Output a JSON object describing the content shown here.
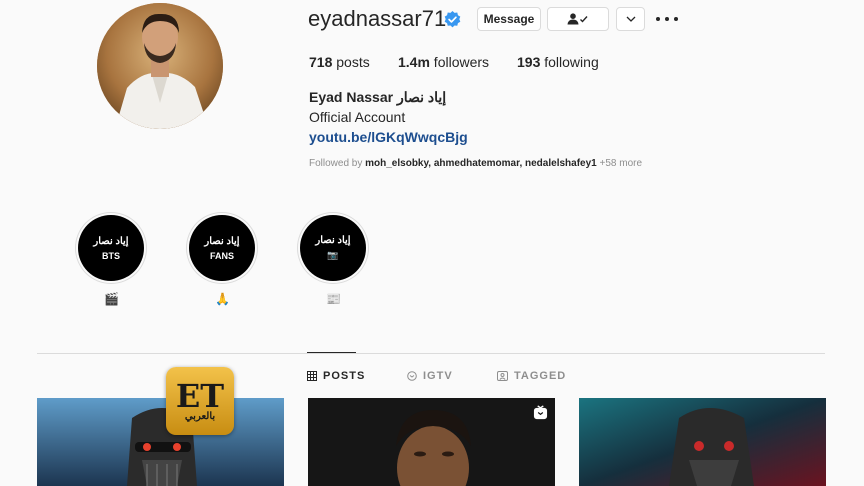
{
  "profile": {
    "username": "eyadnassar71",
    "full_name": "Eyad Nassar إياد نصار",
    "category": "Official Account",
    "link": "youtu.be/lGKqWwqcBjg",
    "followed_by_prefix": "Followed by ",
    "followed_by_names": "moh_elsobky, ahmedhatemomar, nedalelshafey1",
    "followed_by_more": " +58 more"
  },
  "actions": {
    "message_label": "Message",
    "follow_icon": "person-check-icon",
    "chevron_icon": "chevron-down-icon",
    "more_icon": "more-icon"
  },
  "stats": {
    "posts_count": "718",
    "posts_label": " posts",
    "followers_count": "1.4m",
    "followers_label": " followers",
    "following_count": "193",
    "following_label": " following"
  },
  "highlights": [
    {
      "avatar_text": "إياد نصار",
      "avatar_sub": "BTS",
      "caption": "🎬"
    },
    {
      "avatar_text": "إياد نصار",
      "avatar_sub": "FANS",
      "caption": "🙏"
    },
    {
      "avatar_text": "إياد نصار",
      "avatar_sub": "📷",
      "caption": "📰"
    }
  ],
  "tabs": [
    {
      "label": "POSTS",
      "icon": "grid-icon"
    },
    {
      "label": "IGTV",
      "icon": "igtv-icon"
    },
    {
      "label": "TAGGED",
      "icon": "tagged-icon"
    }
  ],
  "watermark": {
    "main": "ET",
    "sub": "بالعربي"
  },
  "colors": {
    "link": "#1d4e8f",
    "verified": "#3897f0",
    "muted": "#8e8e8e"
  }
}
